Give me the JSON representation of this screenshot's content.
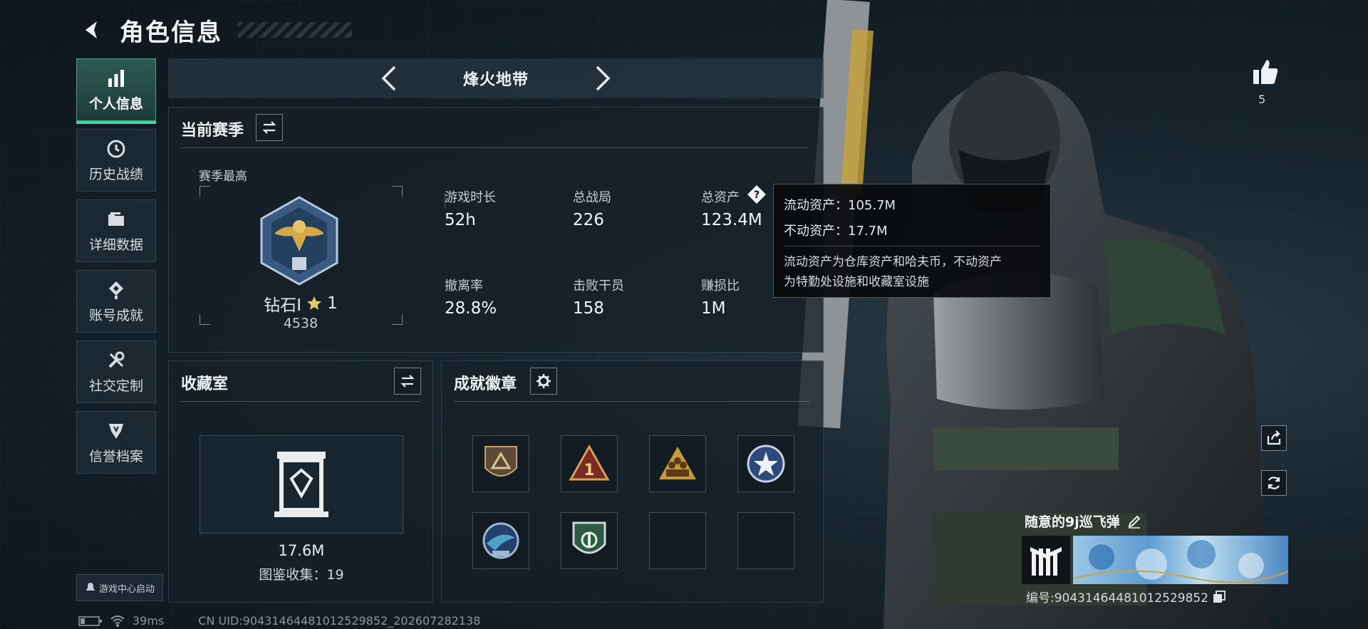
{
  "header": {
    "title": "角色信息"
  },
  "sidebar": {
    "items": [
      {
        "label": "个人信息",
        "icon": "bar-chart-icon"
      },
      {
        "label": "历史战绩",
        "icon": "clock-icon"
      },
      {
        "label": "详细数据",
        "icon": "folder-icon"
      },
      {
        "label": "账号成就",
        "icon": "medal-icon"
      },
      {
        "label": "社交定制",
        "icon": "tools-icon"
      },
      {
        "label": "信誉档案",
        "icon": "shield-icon"
      }
    ],
    "active_index": 0
  },
  "game_center": {
    "label": "游戏中心启动"
  },
  "mode": {
    "title": "烽火地带"
  },
  "season": {
    "title": "当前赛季",
    "best_label": "赛季最高",
    "rank_name": "钻石Ⅰ",
    "rank_stars": "1",
    "rank_score": "4538",
    "stats": [
      {
        "label": "游戏时长",
        "value": "52h"
      },
      {
        "label": "总战局",
        "value": "226"
      },
      {
        "label": "总资产",
        "value": "123.4M"
      },
      {
        "label": "撤离率",
        "value": "28.8%"
      },
      {
        "label": "击败干员",
        "value": "158"
      },
      {
        "label": "赚损比",
        "value": "1M"
      }
    ]
  },
  "tooltip": {
    "liquid": "流动资产：105.7M",
    "fixed": "不动资产：17.7M",
    "note_line1": "流动资产为仓库资产和哈夫币，不动资产",
    "note_line2": "为特勤处设施和收藏室设施"
  },
  "collection": {
    "title": "收藏室",
    "value": "17.6M",
    "catalog": "图鉴收集：19"
  },
  "badges": {
    "title": "成就徽章",
    "items": [
      "triangle-badge-icon",
      "number-one-badge-icon",
      "team-badge-icon",
      "star-badge-icon",
      "wings-badge-icon",
      "shield-badge-icon",
      "",
      ""
    ]
  },
  "profile": {
    "likes": "5",
    "name": "随意的9j巡飞弹",
    "id": "编号:9043146448101252985​2"
  },
  "status": {
    "ping": "39ms",
    "uid": "CN UID:9043146448101252985​2_202607282138"
  },
  "colors": {
    "accent": "#3ed79c",
    "panel": "#16202a"
  }
}
